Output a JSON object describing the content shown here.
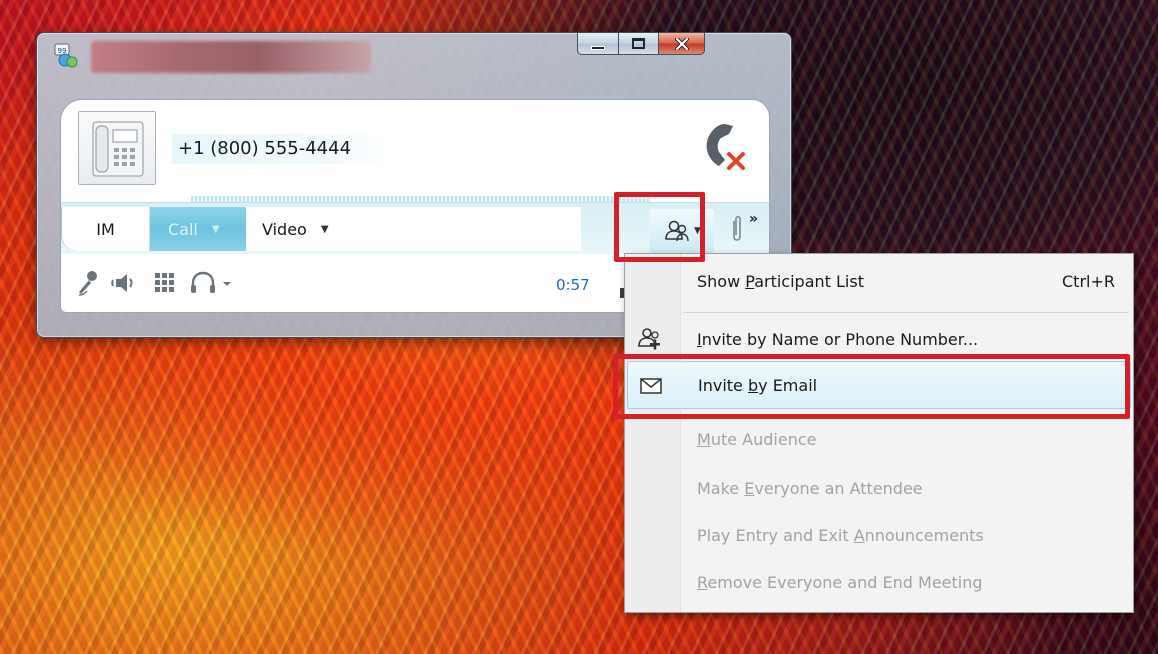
{
  "conversation": {
    "phone_number": "+1 (800) 555-4444",
    "tabs": {
      "im": "IM",
      "call": "Call",
      "video": "Video"
    },
    "call_timer": "0:57",
    "overflow_label": "»"
  },
  "menu": {
    "show_participant_list": {
      "pre": "Show ",
      "accel": "P",
      "post": "articipant List",
      "shortcut": "Ctrl+R"
    },
    "invite_by_name": {
      "pre": "",
      "accel": "I",
      "post": "nvite by Name or Phone Number..."
    },
    "invite_by_email": {
      "pre": "Invite ",
      "accel": "b",
      "post": "y Email"
    },
    "mute_audience": {
      "pre": "",
      "accel": "M",
      "post": "ute Audience"
    },
    "make_attendee": {
      "pre": "Make ",
      "accel": "E",
      "post": "veryone an Attendee"
    },
    "announcements": {
      "pre": "Play Entry and Exit ",
      "accel": "A",
      "post": "nnouncements"
    },
    "remove_everyone": {
      "pre": "",
      "accel": "R",
      "post": "emove Everyone and End Meeting"
    }
  },
  "icons": {
    "app": "lync-app-icon",
    "phone_card": "desk-phone-icon",
    "end_call": "hang-up-icon",
    "participants": "people-icon",
    "attach": "paperclip-icon",
    "mic": "microphone-icon",
    "speaker": "speaker-icon",
    "dialpad": "dialpad-icon",
    "headset": "headset-icon",
    "signal": "signal-icon",
    "invite_people": "add-people-icon",
    "email": "envelope-icon"
  },
  "colors": {
    "highlight": "#d4202a",
    "call_tab": "#6ec4e0",
    "timer": "#1e6fb5",
    "hangup": "#d9472b"
  }
}
